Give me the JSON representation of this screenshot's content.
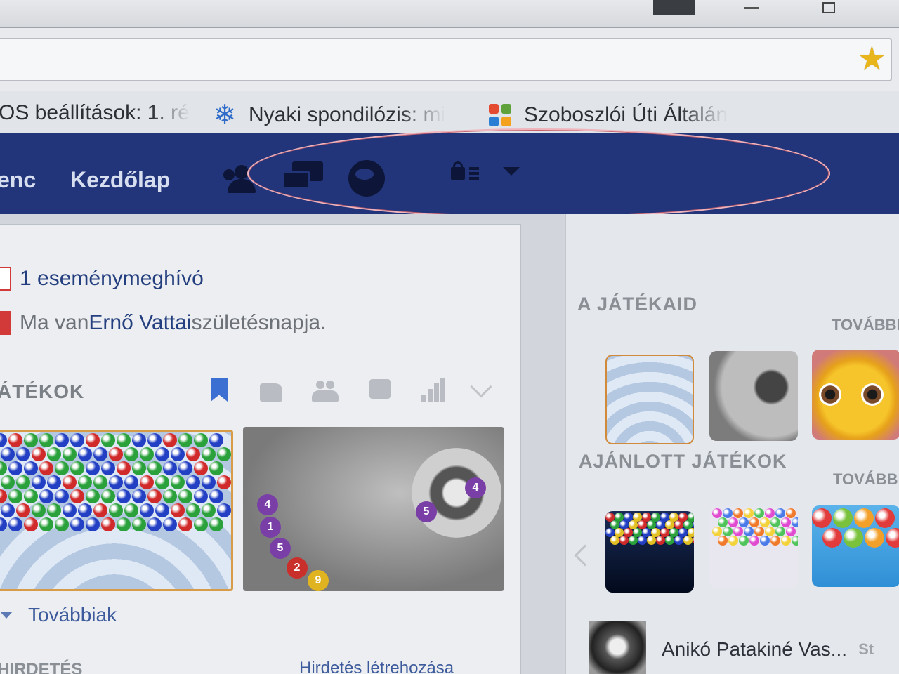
{
  "bookmarks": [
    {
      "label": "OS beállítások: 1. ré",
      "icon": "page-icon"
    },
    {
      "label": "Nyaki spondilózis: mi",
      "icon": "snowflake-icon"
    },
    {
      "label": "Szoboszlói Úti Általán",
      "icon": "joomla-icon"
    }
  ],
  "fb": {
    "nav_profile": "enc",
    "nav_home": "Kezdőlap"
  },
  "notices": {
    "event_invite": "1 eseménymeghívó",
    "birthday_prefix": "Ma van ",
    "birthday_name": "Ernő Vattai",
    "birthday_suffix": " születésnapja."
  },
  "games_section": {
    "title": "ÁTÉKOK",
    "more": "Továbbiak"
  },
  "ads": {
    "title": "HIRDETÉS",
    "create": "Hirdetés létrehozása"
  },
  "right": {
    "your_games": "A JÁTÉKAID",
    "your_games_more": "TOVÁBBI",
    "recommended": "AJÁNLOTT JÁTÉKOK",
    "recommended_more": "TOVÁBBI",
    "friend_name": "Anikó Patakiné Vas...",
    "friend_extra": "St"
  },
  "colors": {
    "fb_blue": "#23357a",
    "highlight": "#f0b4bc",
    "link": "#243f7f",
    "star": "#e8b51c"
  }
}
